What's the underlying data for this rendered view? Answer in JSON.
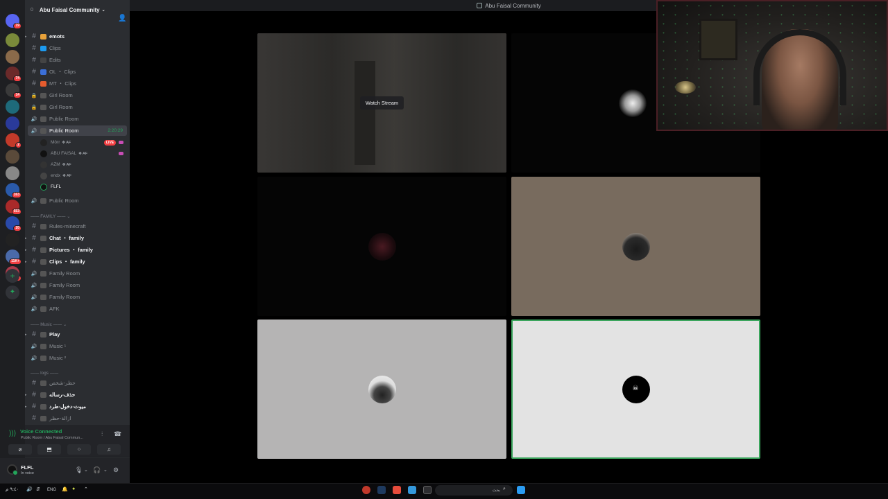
{
  "window": {
    "title": "Abu Faisal Community"
  },
  "server": {
    "name": "Abu Faisal Community",
    "count": "0"
  },
  "rail": {
    "items": [
      {
        "name": "direct-messages",
        "badge": "19",
        "color": "#5865f2"
      },
      {
        "name": "server-1",
        "badge": "",
        "color": "#7a8a3a"
      },
      {
        "name": "server-2",
        "badge": "",
        "color": "#8a6a4a"
      },
      {
        "name": "server-3",
        "badge": "74",
        "color": "#6b2a2a"
      },
      {
        "name": "server-4",
        "badge": "14",
        "color": "#3a3a3a"
      },
      {
        "name": "server-abu-faisal",
        "badge": "",
        "color": "#1e6a7a"
      },
      {
        "name": "server-6",
        "badge": "",
        "color": "#2a3a9a"
      },
      {
        "name": "server-7",
        "badge": "2",
        "color": "#c23a2a"
      },
      {
        "name": "server-8",
        "badge": "",
        "color": "#5a4a3a"
      },
      {
        "name": "server-9",
        "badge": "",
        "color": "#888888"
      },
      {
        "name": "server-10",
        "badge": "163",
        "color": "#2a5aaa"
      },
      {
        "name": "server-11",
        "badge": "553",
        "color": "#aa2a2a"
      },
      {
        "name": "server-12",
        "badge": "20",
        "color": "#2a4aaa"
      },
      {
        "name": "server-13",
        "badge": "",
        "color": "#222222"
      },
      {
        "name": "server-14",
        "badge": "11K+",
        "color": "#4a6aaa"
      },
      {
        "name": "server-15",
        "badge": "2K+",
        "color": "#aa3a4a"
      }
    ]
  },
  "channels": [
    {
      "label": "emots",
      "type": "text",
      "bold": true,
      "arrow": true,
      "emoji_color": "#e7a13a"
    },
    {
      "label": "Clips",
      "type": "text",
      "emoji_color": "#1d9bf0"
    },
    {
      "label": "Edits",
      "type": "text",
      "emoji_color": "#444"
    },
    {
      "label": "OL ・ Clips",
      "type": "text",
      "emoji_color": "#3b6fd8"
    },
    {
      "label": "MT ・ Clips",
      "type": "text",
      "emoji_color": "#e65c2e"
    },
    {
      "label": "Girl Room",
      "type": "locked",
      "emoji_color": "#555"
    },
    {
      "label": "Girl Room",
      "type": "locked",
      "emoji_color": "#555"
    },
    {
      "label": "Public Room",
      "type": "voice",
      "emoji_color": "#555"
    },
    {
      "label": "Public Room",
      "type": "voice-active",
      "timer": "2:20:29",
      "emoji_color": "#555"
    }
  ],
  "members": [
    {
      "name": "Mörr",
      "tag": "✥ AF",
      "live": "LIVE"
    },
    {
      "name": "ABU FAISAL",
      "tag": "✥ AF",
      "live": ""
    },
    {
      "name": "AZM",
      "tag": "✥ AF",
      "live": ""
    },
    {
      "name": "endx",
      "tag": "✥ AF",
      "live": ""
    },
    {
      "name": "FLFL",
      "tag": "",
      "live": ""
    }
  ],
  "channels2": [
    {
      "label": "Public Room",
      "type": "voice"
    }
  ],
  "categories": {
    "family": "—— FAMILY —— ⌄",
    "music": "—— Music —— ⌄",
    "logs": "—— logs ——"
  },
  "family_channels": [
    {
      "label": "Rules-minecraft",
      "type": "text"
    },
    {
      "label": "Chat ・ family",
      "type": "text",
      "bold": true,
      "arrow": true
    },
    {
      "label": "Pictures ・ family",
      "type": "text",
      "bold": true,
      "arrow": true
    },
    {
      "label": "Clips ・ family",
      "type": "text",
      "bold": true,
      "arrow": true
    },
    {
      "label": "Family Room",
      "type": "voice"
    },
    {
      "label": "Family Room",
      "type": "voice"
    },
    {
      "label": "Family Room",
      "type": "voice"
    },
    {
      "label": "AFK",
      "type": "voice"
    }
  ],
  "music_channels": [
    {
      "label": "Play",
      "type": "text",
      "bold": true,
      "arrow": true
    },
    {
      "label": "Music ¹",
      "type": "voice"
    },
    {
      "label": "Music ²",
      "type": "voice"
    }
  ],
  "log_channels": [
    {
      "label": "حظر-شخص",
      "type": "text"
    },
    {
      "label": "حذف-رساله",
      "type": "text",
      "arrow": true,
      "bold": true
    },
    {
      "label": "ميوت-دخول-طرد",
      "type": "text",
      "arrow": true,
      "bold": true
    },
    {
      "label": "ازالة-حظر",
      "type": "text"
    }
  ],
  "voice": {
    "status": "Voice Connected",
    "sub": "Public Room / Abu Faisal Commun..."
  },
  "user": {
    "name": "FLFL",
    "status": "In voice"
  },
  "stage": {
    "watch_label": "Watch Stream"
  },
  "taskbar": {
    "lang": "ENG",
    "search": "بحث",
    "clock": "٩:٤٠ م"
  },
  "colors": {
    "green": "#23a55a",
    "live_red": "#f23f42",
    "active_border": "#3ba55d"
  }
}
